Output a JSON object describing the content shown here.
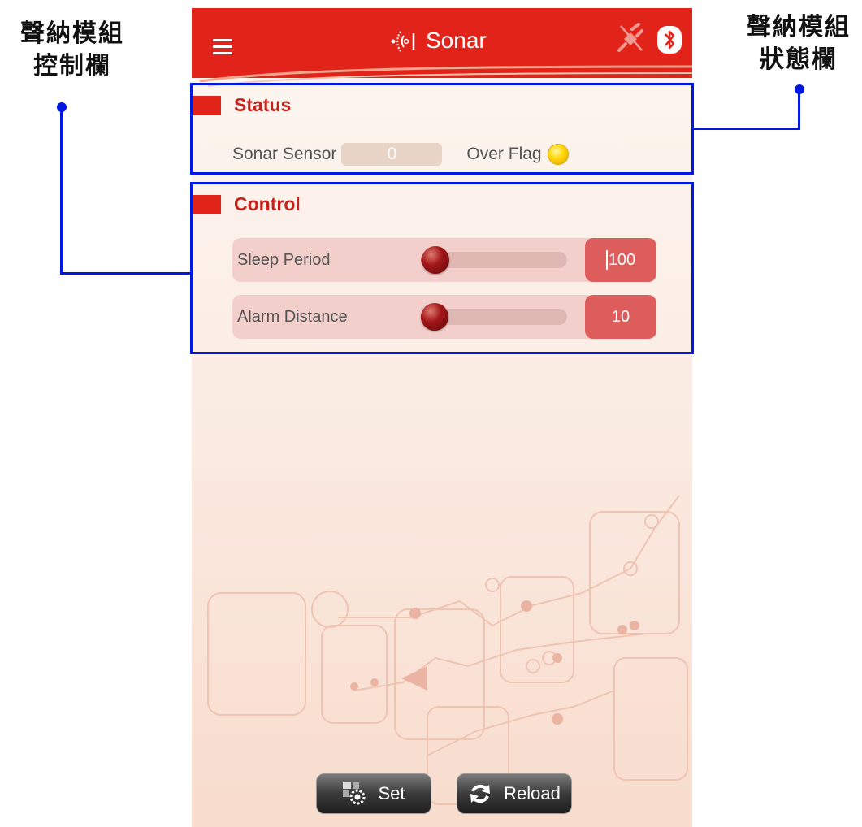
{
  "annotations": {
    "left_label_line1": "聲納模組",
    "left_label_line2": "控制欄",
    "right_label_line1": "聲納模組",
    "right_label_line2": "狀態欄",
    "frame_color": "#0018e0"
  },
  "app": {
    "title": "Sonar",
    "menu_icon": "hamburger-menu-icon",
    "title_icon": "sonar-icon",
    "connection_icon": "disconnected-plug-icon",
    "bluetooth_icon": "bluetooth-icon",
    "accent_color": "#e2231a"
  },
  "status": {
    "header": "Status",
    "sensor_label": "Sonar Sensor",
    "sensor_value": "0",
    "flag_label": "Over Flag",
    "flag_color": "#ffd500"
  },
  "control": {
    "header": "Control",
    "sleep_period": {
      "label": "Sleep Period",
      "value": "100",
      "slider_fraction": 0.1
    },
    "alarm_distance": {
      "label": "Alarm Distance",
      "value": "10",
      "slider_fraction": 0.08
    }
  },
  "buttons": {
    "set_label": "Set",
    "reload_label": "Reload"
  }
}
